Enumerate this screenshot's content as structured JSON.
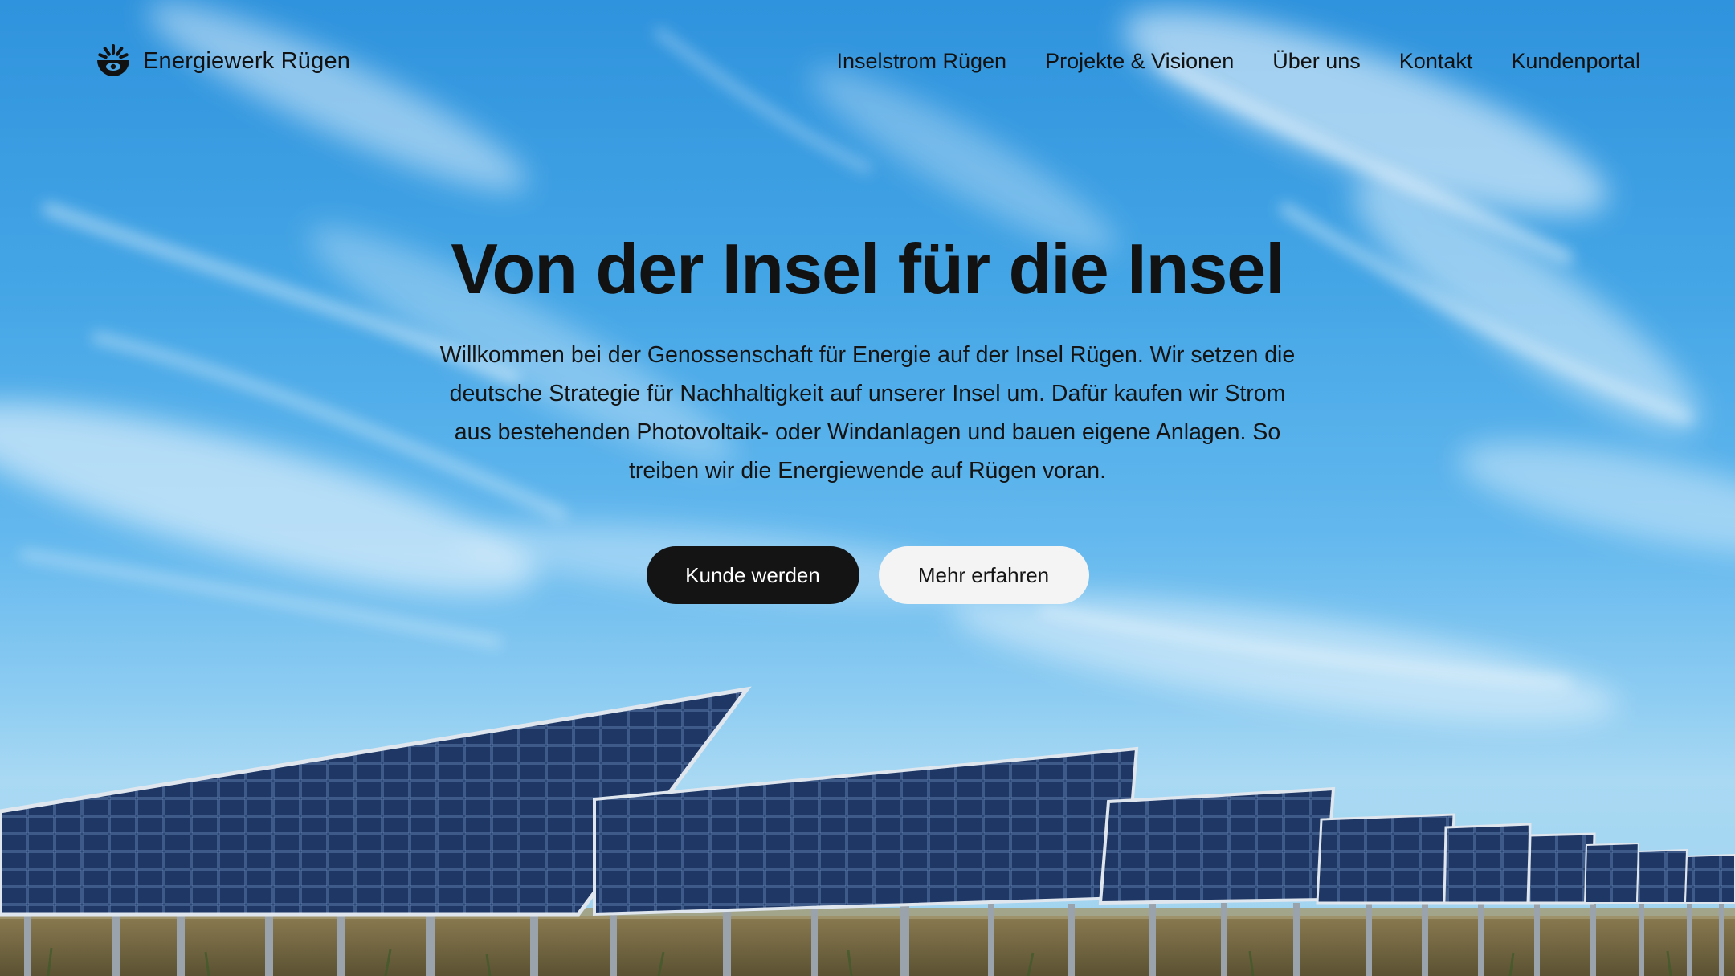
{
  "brand": {
    "name": "Energiewerk Rügen",
    "logo_icon": "sun-eye-logo-icon"
  },
  "nav": {
    "items": [
      {
        "label": "Inselstrom Rügen"
      },
      {
        "label": "Projekte & Visionen"
      },
      {
        "label": "Über uns"
      },
      {
        "label": "Kontakt"
      },
      {
        "label": "Kundenportal"
      }
    ]
  },
  "hero": {
    "title": "Von der Insel für die Insel",
    "text": "Willkommen bei der Genossenschaft für Energie auf der Insel Rügen. Wir setzen die deutsche Strategie für Nachhaltigkeit auf unserer Insel um. Dafür kaufen wir Strom aus bestehenden Photovoltaik- oder Windanlagen und bauen eigene Anlagen. So treiben wir die Energiewende auf Rügen voran.",
    "primary_button": "Kunde werden",
    "secondary_button": "Mehr erfahren"
  },
  "colors": {
    "sky_top": "#2f93dd",
    "sky_bottom": "#a9d9f3",
    "text": "#121212",
    "button_dark": "#141414",
    "button_light": "#f4f4f4",
    "panel": "#1f3a6b"
  },
  "background": {
    "image": "solar-park-under-blue-sky"
  }
}
